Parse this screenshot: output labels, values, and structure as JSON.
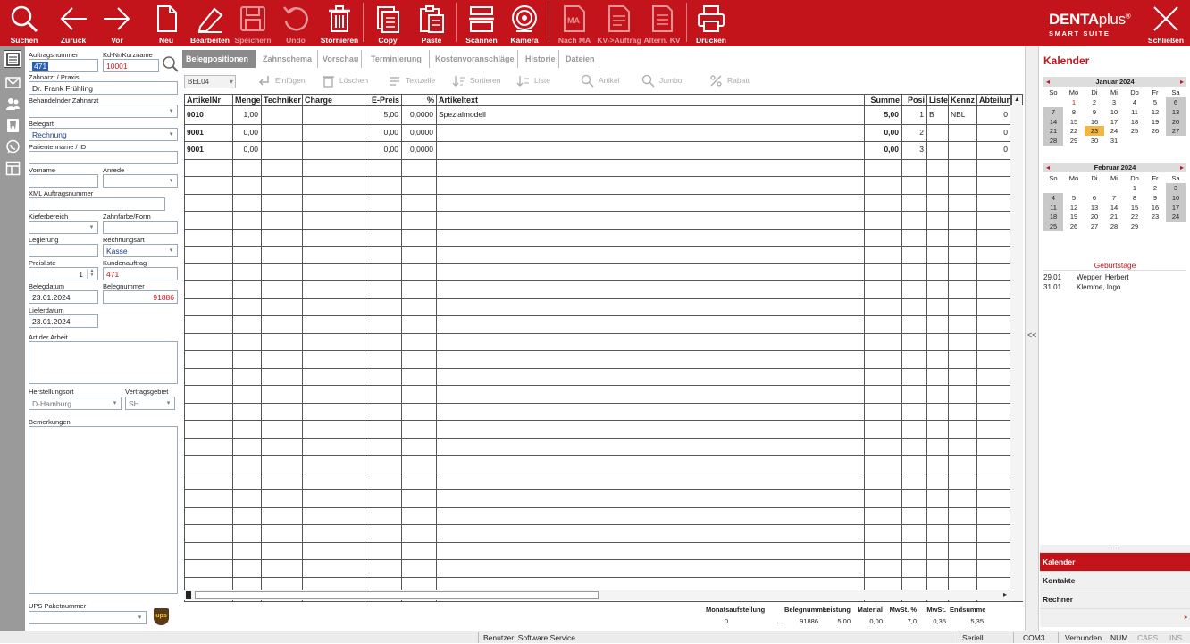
{
  "toolbar": {
    "buttons": [
      {
        "label": "Suchen",
        "icon": "search-icon"
      },
      {
        "label": "Zurück",
        "icon": "arrow-left-icon"
      },
      {
        "label": "Vor",
        "icon": "arrow-right-icon"
      },
      {
        "label": "Neu",
        "icon": "new-document-icon"
      },
      {
        "label": "Bearbeiten",
        "icon": "pencil-icon"
      },
      {
        "label": "Speichern",
        "icon": "save-icon"
      },
      {
        "label": "Undo",
        "icon": "undo-icon"
      },
      {
        "label": "Stornieren",
        "icon": "trash-icon"
      },
      {
        "label": "Copy",
        "icon": "copy-icon"
      },
      {
        "label": "Paste",
        "icon": "paste-icon"
      },
      {
        "label": "Scannen",
        "icon": "scanner-icon"
      },
      {
        "label": "Kamera",
        "icon": "camera-icon"
      },
      {
        "label": "Nach MA",
        "icon": "to-employee-icon"
      },
      {
        "label": "KV->Auftrag",
        "icon": "cost-estimate-to-order-icon"
      },
      {
        "label": "Altern. KV",
        "icon": "alternative-estimate-icon"
      },
      {
        "label": "Drucken",
        "icon": "printer-icon"
      },
      {
        "label": "Schließen",
        "icon": "close-icon"
      }
    ],
    "logo_main": "DENTA",
    "logo_suffix": "plus",
    "logo_reg": "®",
    "logo_sub": "SMART SUITE"
  },
  "form": {
    "auftragsnummer_label": "Auftragsnummer",
    "auftragsnummer": "471",
    "kdnr_label": "Kd-Nr/Kurzname",
    "kdnr": "10001",
    "zahnarzt_label": "Zahnarzt / Praxis",
    "zahnarzt": "Dr. Frank Frühling",
    "behandelnder_label": "Behandelnder Zahnarzt",
    "behandelnder": "",
    "belegart_label": "Belegart",
    "belegart": "Rechnung",
    "patient_label": "Patientenname / ID",
    "patient": "",
    "vorname_label": "Vorname",
    "vorname": "",
    "anrede_label": "Anrede",
    "anrede": "",
    "xml_label": "XML Auftragsnummer",
    "xml": "",
    "kieferbereich_label": "Kieferbereich",
    "kieferbereich": "",
    "zahnfarbe_label": "Zahnfarbe/Form",
    "zahnfarbe": "",
    "legierung_label": "Legierung",
    "legierung": "",
    "rechnungsart_label": "Rechnungsart",
    "rechnungsart": "Kasse",
    "preisliste_label": "Preisliste",
    "preisliste": "1",
    "kundenauftrag_label": "Kundenauftrag",
    "kundenauftrag": "471",
    "belegdatum_label": "Belegdatum",
    "belegdatum": "23.01.2024",
    "belegnummer_label": "Belegnummer",
    "belegnummer": "91886",
    "lieferdatum_label": "Lieferdatum",
    "lieferdatum": "23.01.2024",
    "artderarbeit_label": "Art der Arbeit",
    "artderarbeit": "",
    "herstellungsort_label": "Herstellungsort",
    "herstellungsort": "D-Hamburg",
    "vertragsgebiet_label": "Vertragsgebiet",
    "vertragsgebiet": "SH",
    "bemerkungen_label": "Bemerkungen",
    "bemerkungen": "",
    "ups_label": "UPS Paketnummer",
    "ups": "",
    "ups_logo": "ups"
  },
  "tabs": [
    "Belegpositionen",
    "Zahnschema",
    "Vorschau",
    "Terminierung",
    "Kostenvoranschläge",
    "Historie",
    "Dateien"
  ],
  "subtoolbar": {
    "dropdown": "BEL04",
    "buttons": [
      {
        "label": "Einfügen",
        "icon": "insert-icon"
      },
      {
        "label": "Löschen",
        "icon": "delete-icon"
      },
      {
        "label": "Textzeile",
        "icon": "text-line-icon"
      },
      {
        "label": "Sortieren",
        "icon": "sort-icon"
      },
      {
        "label": "Liste",
        "icon": "list-icon"
      },
      {
        "label": "Artikel",
        "icon": "article-search-icon"
      },
      {
        "label": "Jumbo",
        "icon": "jumbo-search-icon"
      },
      {
        "label": "Rabatt",
        "icon": "discount-icon"
      }
    ]
  },
  "grid": {
    "columns": [
      "ArtikelNr",
      "Menge",
      "Techniker",
      "Charge",
      "E-Preis",
      "%",
      "Artikeltext",
      "Summe",
      "Posi",
      "Liste",
      "Kennz",
      "Abteilun"
    ],
    "rows": [
      [
        "0010",
        "1,00",
        "",
        "",
        "5,00",
        "0,0000",
        "Spezialmodell",
        "5,00",
        "1",
        "B",
        "NBL",
        "0"
      ],
      [
        "9001",
        "0,00",
        "",
        "",
        "0,00",
        "0,0000",
        "",
        "0,00",
        "2",
        "",
        "",
        "0"
      ],
      [
        "9001",
        "0,00",
        "",
        "",
        "0,00",
        "0,0000",
        "",
        "0,00",
        "3",
        "",
        "",
        "0"
      ]
    ]
  },
  "calendar": {
    "title": "Kalender",
    "weekdays": [
      "So",
      "Mo",
      "Di",
      "Mi",
      "Do",
      "Fr",
      "Sa"
    ],
    "months": [
      {
        "name": "Januar 2024",
        "start": 1,
        "days": 31,
        "today": 23,
        "marked": 1
      },
      {
        "name": "Februar 2024",
        "start": 4,
        "days": 29,
        "today": 0,
        "marked": 0
      }
    ]
  },
  "birthdays": {
    "title": "Geburtstage",
    "items": [
      {
        "date": "29.01",
        "name": "Wepper, Herbert"
      },
      {
        "date": "31.01",
        "name": "Klemme, Ingo"
      }
    ]
  },
  "rightnav": [
    "Kalender",
    "Kontakte",
    "Rechner"
  ],
  "totals": [
    {
      "label": "Monatsaufstellung",
      "value": "0"
    },
    {
      "label": "",
      "value": ". ."
    },
    {
      "label": "Belegnummer",
      "value": "91886"
    },
    {
      "label": "Leistung",
      "value": "5,00"
    },
    {
      "label": "Material",
      "value": "0,00"
    },
    {
      "label": "MwSt. %",
      "value": "7,0"
    },
    {
      "label": "MwSt.",
      "value": "0,35"
    },
    {
      "label": "Endsumme",
      "value": "5,35"
    }
  ],
  "status": {
    "user": "Benutzer: Software Service",
    "port": "Seriell",
    "com": "COM3",
    "conn": "Verbunden",
    "num": "NUM",
    "caps": "CAPS",
    "ins": "INS"
  },
  "splitter_label": "<<",
  "colors": {
    "brand": "#c4141b",
    "today": "#f3b644"
  }
}
